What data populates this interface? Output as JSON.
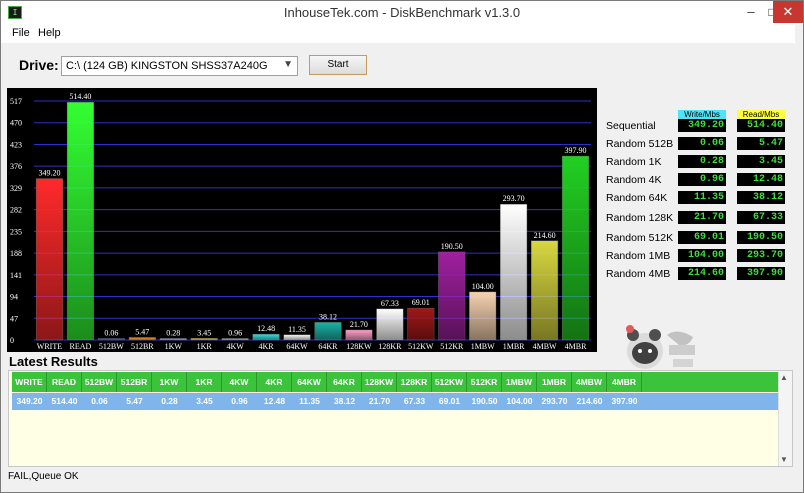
{
  "window": {
    "title": "InhouseTek.com - DiskBenchmark v1.3.0",
    "icon": "app-icon",
    "icon_text": "I"
  },
  "menu": {
    "file": "File",
    "help": "Help"
  },
  "drive": {
    "label": "Drive:",
    "value": "C:\\ (124 GB) KINGSTON SHSS37A240G",
    "start": "Start"
  },
  "results_header": {
    "write": "Write/Mbs",
    "read": "Read/Mbs"
  },
  "results": [
    {
      "label": "Sequential",
      "write": "349.20",
      "read": "514.40"
    },
    {
      "label": "Random 512B",
      "write": "0.06",
      "read": "5.47"
    },
    {
      "label": "Random 1K",
      "write": "0.28",
      "read": "3.45"
    },
    {
      "label": "Random 4K",
      "write": "0.96",
      "read": "12.48"
    },
    {
      "label": "Random 64K",
      "write": "11.35",
      "read": "38.12"
    },
    {
      "label": "Random 128K",
      "write": "21.70",
      "read": "67.33"
    },
    {
      "label": "Random 512K",
      "write": "69.01",
      "read": "190.50"
    },
    {
      "label": "Random 1MB",
      "write": "104.00",
      "read": "293.70"
    },
    {
      "label": "Random 4MB",
      "write": "214.60",
      "read": "397.90"
    }
  ],
  "latest": {
    "title": "Latest Results",
    "headers": [
      "WRITE",
      "READ",
      "512BW",
      "512BR",
      "1KW",
      "1KR",
      "4KW",
      "4KR",
      "64KW",
      "64KR",
      "128KW",
      "128KR",
      "512KW",
      "512KR",
      "1MBW",
      "1MBR",
      "4MBW",
      "4MBR"
    ],
    "row": [
      "349.20",
      "514.40",
      "0.06",
      "5.47",
      "0.28",
      "3.45",
      "0.96",
      "12.48",
      "11.35",
      "38.12",
      "21.70",
      "67.33",
      "69.01",
      "190.50",
      "104.00",
      "293.70",
      "214.60",
      "397.90"
    ]
  },
  "status": "FAIL,Queue OK",
  "chart_data": {
    "type": "bar",
    "categories": [
      "WRITE",
      "READ",
      "512BW",
      "512BR",
      "1KW",
      "1KR",
      "4KW",
      "4KR",
      "64KW",
      "64KR",
      "128KW",
      "128KR",
      "512KW",
      "512KR",
      "1MBW",
      "1MBR",
      "4MBW",
      "4MBR"
    ],
    "values": [
      349.2,
      514.4,
      0.06,
      5.47,
      0.28,
      3.45,
      0.96,
      12.48,
      11.35,
      38.12,
      21.7,
      67.33,
      69.01,
      190.5,
      104.0,
      293.7,
      214.6,
      397.9
    ],
    "value_labels": [
      "349.20",
      "514.40",
      "0.06",
      "5.47",
      "0.28",
      "3.45",
      "0.96",
      "12.48",
      "11.35",
      "38.12",
      "21.70",
      "67.33",
      "69.01",
      "190.50",
      "104.00",
      "293.70",
      "214.60",
      "397.90"
    ],
    "colors": [
      "#ff2a2a",
      "#33ff33",
      "#3a5fd8",
      "#ff9922",
      "#c0a9ff",
      "#f0d030",
      "#c0c0c0",
      "#33e0e0",
      "#f8f8f8",
      "#1bb3a6",
      "#ff9fc8",
      "#ffffff",
      "#a01818",
      "#a020a0",
      "#f6d2b0",
      "#ffffff",
      "#d8d840",
      "#22d022"
    ],
    "yticks": [
      0,
      47,
      94,
      141,
      188,
      235,
      282,
      329,
      376,
      423,
      470,
      517
    ],
    "ylim": [
      0,
      517
    ],
    "grid": true,
    "background": "#000000",
    "gridline_color": "#3030c8"
  }
}
